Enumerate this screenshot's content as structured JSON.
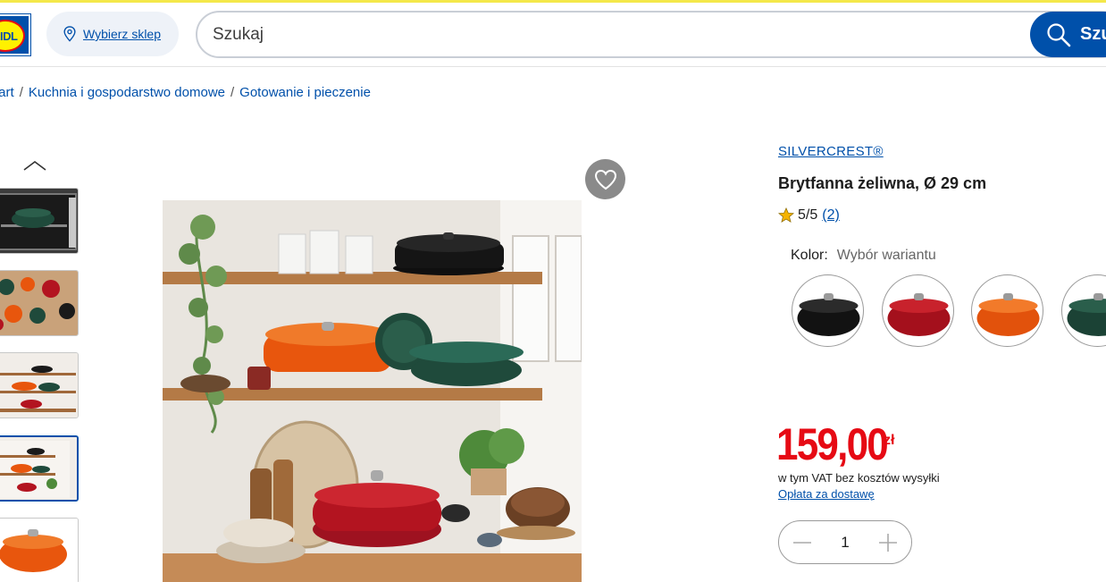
{
  "header": {
    "logo_text": "LIDL",
    "store_button_label": "Wybierz sklep",
    "search_placeholder": "Szukaj",
    "search_button_label": "Szu"
  },
  "breadcrumb": {
    "items": [
      "Start",
      "Kuchnia i gospodarstwo domowe",
      "Gotowanie i pieczenie"
    ],
    "first_visible": "tart"
  },
  "product": {
    "brand": "SILVERCREST®",
    "title": "Brytfanna żeliwna, Ø 29 cm",
    "rating_value": "5/5",
    "rating_count": "(2)",
    "color_label": "Kolor:",
    "color_value": "Wybór wariantu",
    "swatches": [
      {
        "name": "black",
        "color": "#1a1a1a"
      },
      {
        "name": "red",
        "color": "#b31420"
      },
      {
        "name": "orange",
        "color": "#e8560d"
      },
      {
        "name": "green",
        "color": "#1f4a3b"
      }
    ],
    "price_main": "159,00",
    "price_currency": "zł",
    "vat_text": "w tym VAT bez kosztów wysyłki",
    "delivery_link": "Opłata za dostawę",
    "quantity": "1"
  },
  "colors": {
    "brand_blue": "#0050aa",
    "price_red": "#e60a14",
    "top_strip": "#f4e84a"
  }
}
